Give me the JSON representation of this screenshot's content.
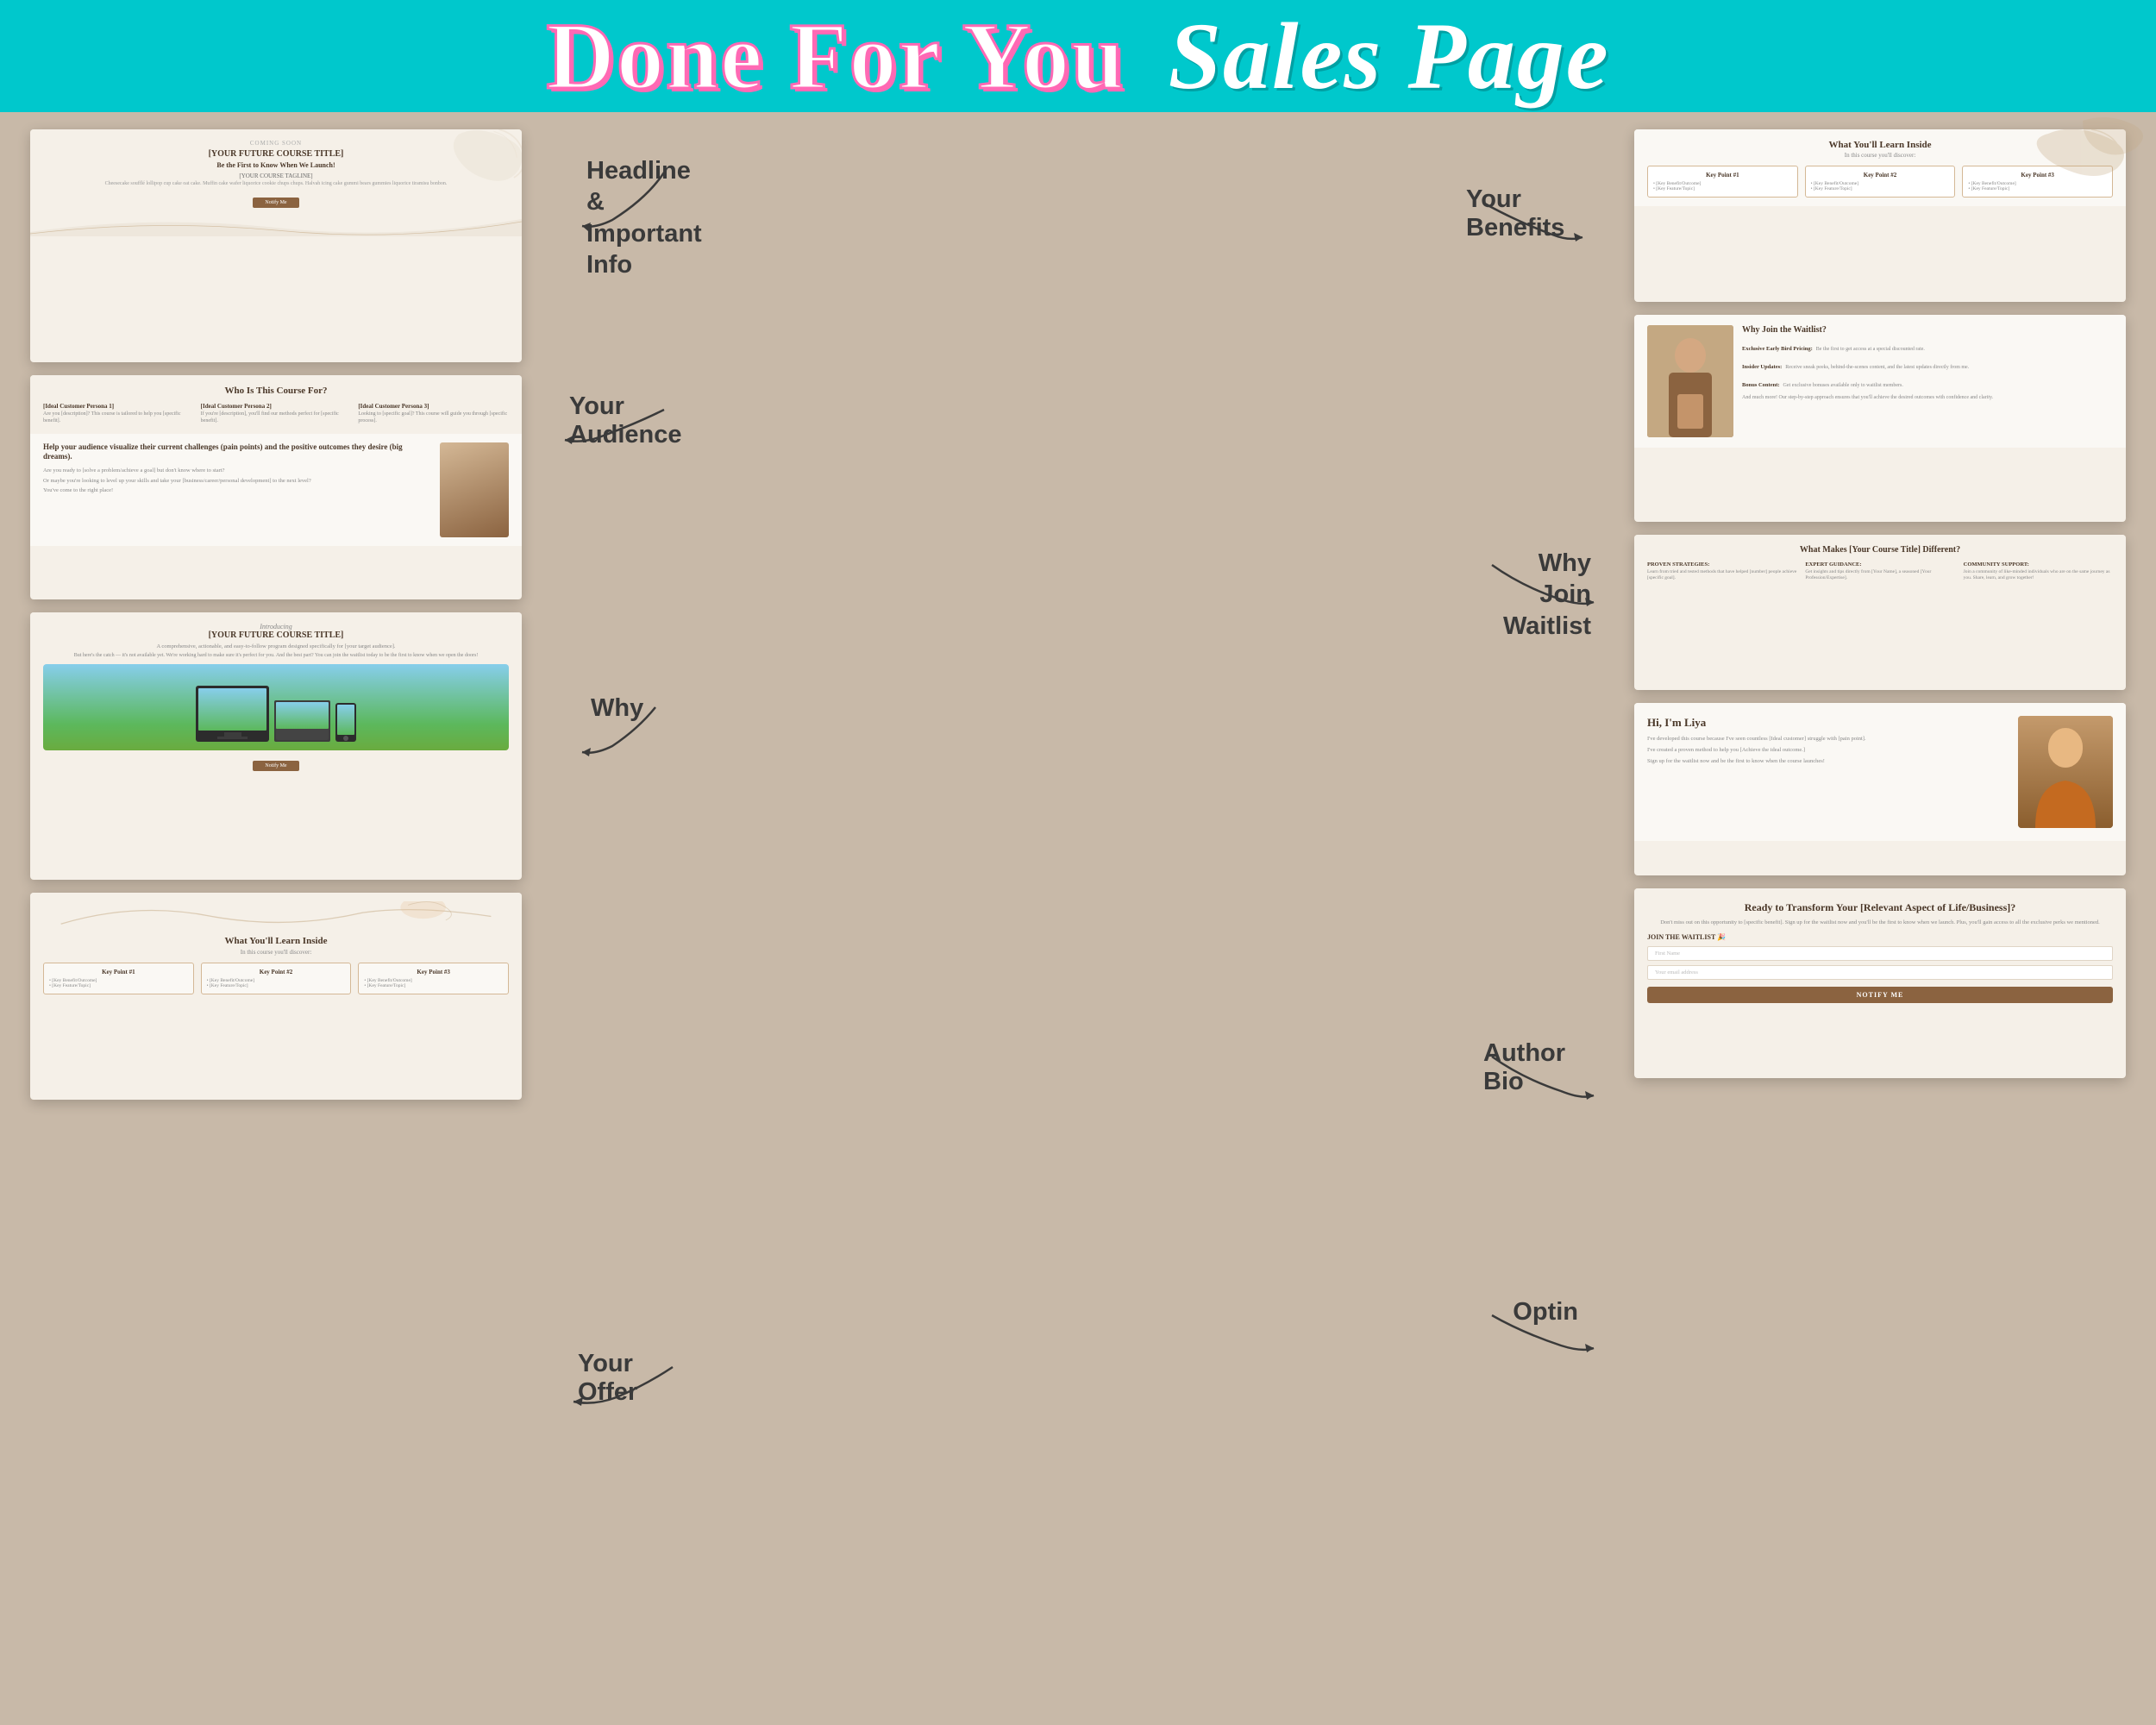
{
  "header": {
    "title_part1": "Done For You",
    "title_part2": "Sales Page"
  },
  "labels": {
    "headline": "Headline &\nImportant\nInfo",
    "audience": "Your Audience",
    "why": "Why",
    "your_offer": "Your Offer",
    "your_benefits": "Your Benefits",
    "why_join": "Why Join\nWaitlist",
    "author_bio": "Author Bio",
    "optin": "Optin"
  },
  "mockup1": {
    "label": "COMING SOON",
    "title": "[YOUR FUTURE COURSE TITLE]",
    "subtitle": "Be the First to Know When We Launch!",
    "body_text": "[YOUR COURSE TAGLINE]",
    "description": "Cheesecake soufflé lollipop cup cake oat cake. Muffin cake wafer liquorice cookie chups chups. Halvah icing cake gummi bears gummies liquorice tiramisu bonbon.",
    "button": "Notify Me"
  },
  "mockup2": {
    "title": "Who Is This Course For?",
    "col1_title": "[Ideal Customer Persona 1]",
    "col1_text": "Are you [description]? This course is tailored to help you [specific benefit].",
    "col2_title": "[Ideal Customer Persona 2]",
    "col2_text": "If you're [description], you'll find our methods perfect for [specific benefit].",
    "col3_title": "[Ideal Customer Persona 3]",
    "col3_text": "Looking to [specific goal]? This course will guide you through [specific process]."
  },
  "mockup3": {
    "headline": "Help your audience visualize their current challenges (pain points) and the positive outcomes they desire (big dreams).",
    "subtext1": "Are you ready to [solve a problem/achieve a goal] but don't know where to start?",
    "subtext2": "Or maybe you're looking to level up your skills and take your [business/career/personal development] to the next level?",
    "subtext3": "You've come to the right place!"
  },
  "mockup4": {
    "introducing": "Introducing",
    "title": "[YOUR FUTURE COURSE TITLE]",
    "desc": "A comprehensive, actionable, and easy-to-follow program designed specifically for [your target audience].",
    "catch": "But here's the catch — it's not available yet. We're working hard to make sure it's perfect for you. And the best part? You can join the waitlist today to be the first to know when we open the doors!",
    "button": "Notify Me"
  },
  "mockup5": {
    "title": "What You'll Learn Inside",
    "subtitle": "In this course you'll discover:",
    "kp1": "Key Point #1",
    "kp2": "Key Point #2",
    "kp3": "Key Point #3",
    "kp1_items": [
      "• [Key Benefit/Outcome]",
      "• [Key Feature/Topic]"
    ],
    "kp2_items": [
      "• [Key Benefit/Outcome]",
      "• [Key Feature/Topic]"
    ],
    "kp3_items": [
      "• [Key Benefit/Outcome]",
      "• [Key Feature/Topic]"
    ]
  },
  "mockup6": {
    "title": "Why Join the Waitlist?",
    "point1_title": "Exclusive Early Bird Pricing:",
    "point1_text": "Be the first to get access at a special discounted rate.",
    "point2_title": "Insider Updates:",
    "point2_text": "Receive sneak peeks, behind-the-scenes content, and the latest updates directly from me.",
    "point3_title": "Bonus Content:",
    "point3_text": "Get exclusive bonuses available only to waitlist members.",
    "closing": "And much more! Our step-by-step approach ensures that you'll achieve the desired outcomes with confidence and clarity."
  },
  "mockup7": {
    "title": "What Makes [Your Course Title] Different?",
    "col1_title": "PROVEN STRATEGIES:",
    "col1_text": "Learn from tried and tested methods that have helped [number] people achieve [specific goal].",
    "col2_title": "EXPERT GUIDANCE:",
    "col2_text": "Get insights and tips directly from [Your Name], a seasoned [Your Profession/Expertise].",
    "col3_title": "COMMUNITY SUPPORT:",
    "col3_text": "Join a community of like-minded individuals who are on the same journey as you. Share, learn, and grow together!"
  },
  "mockup8": {
    "greeting": "Hi, I'm Liya",
    "bio": "I've developed this course because I've seen countless [Ideal customer] struggle with [pain point].",
    "method": "I've created a proven method to help you [Achieve the ideal outcome.]",
    "cta": "Sign up for the waitlist now and be the first to know when the course launches!"
  },
  "mockup9": {
    "title": "Ready to Transform Your [Relevant Aspect of Life/Business]?",
    "text": "Don't miss out on this opportunity to [specific benefit]. Sign up for the waitlist now and you'll be the first to know when we launch. Plus, you'll gain access to all the exclusive perks we mentioned.",
    "join_label": "JOIN THE WAITLIST 🎉",
    "first_name_placeholder": "First Name",
    "email_placeholder": "Your email address",
    "button": "NOTIFY ME"
  },
  "offer_mockup": {
    "title": "What You'll Learn Inside",
    "subtitle": "In this course you'll discover:",
    "kp1": "Key Point #1",
    "kp2": "Key Point #2",
    "kp3": "Key Point #3"
  }
}
